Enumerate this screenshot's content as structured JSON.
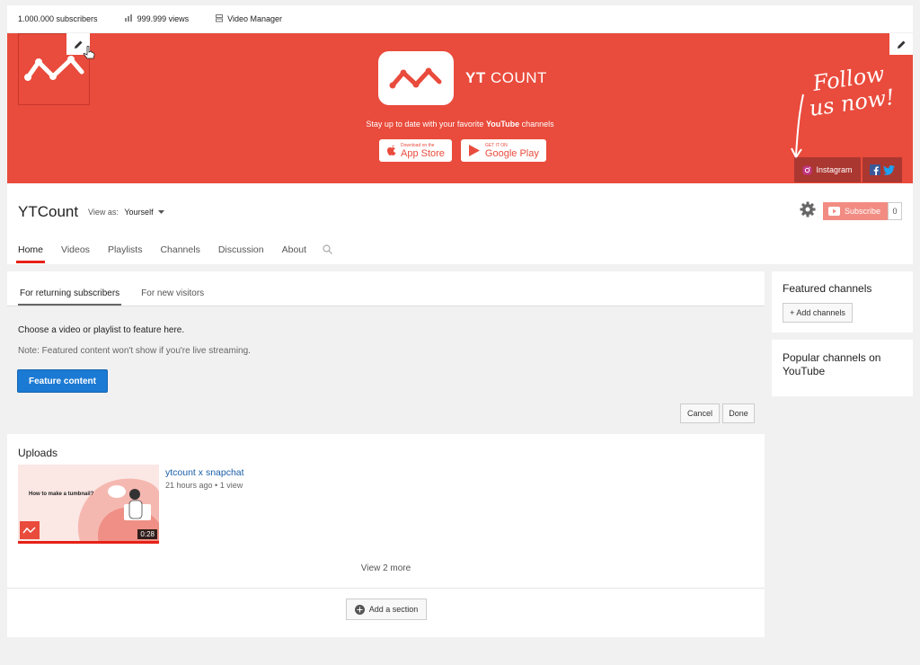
{
  "top_stats": {
    "subscribers": "1.000.000 subscribers",
    "views": "999.999 views",
    "video_manager": "Video Manager"
  },
  "banner": {
    "brand_bold": "YT",
    "brand_rest": " COUNT",
    "tagline_pre": "Stay up to date with your favorite ",
    "tagline_bold": "YouTube",
    "tagline_post": " channels",
    "app_store_small": "Download on the",
    "app_store_big": "App Store",
    "google_play_small": "GET IT ON",
    "google_play_big": "Google Play",
    "follow_line1": "Follow",
    "follow_line2": "us now!",
    "instagram": "Instagram",
    "colors": {
      "banner_bg": "#e94b3c"
    }
  },
  "channel": {
    "title": "YTCount",
    "view_as_label": "View as:",
    "view_as_value": "Yourself",
    "subscribe_label": "Subscribe",
    "subscribe_count": "0",
    "tabs": [
      "Home",
      "Videos",
      "Playlists",
      "Channels",
      "Discussion",
      "About"
    ]
  },
  "featured": {
    "tabs": [
      "For returning subscribers",
      "For new visitors"
    ],
    "line1": "Choose a video or playlist to feature here.",
    "line2": "Note: Featured content won't show if you're live streaming.",
    "feature_button": "Feature content",
    "cancel": "Cancel",
    "done": "Done"
  },
  "uploads": {
    "title": "Uploads",
    "video": {
      "title": "ytcount x snapchat",
      "meta": "21 hours ago  •  1 view",
      "thumb_text": "How to make a tumbnail?",
      "duration": "0:28"
    },
    "view_more": "View 2 more",
    "add_section": "Add a section"
  },
  "sidebar": {
    "featured_channels": "Featured channels",
    "add_channels": "+ Add channels",
    "popular_channels": "Popular channels on YouTube"
  }
}
